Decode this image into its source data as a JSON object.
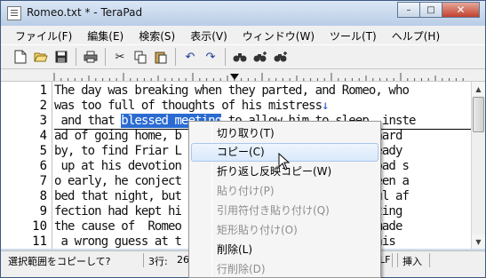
{
  "window": {
    "title": "Romeo.txt * - TeraPad",
    "controls": {
      "minimize": "–",
      "maximize": "□",
      "close": "✕"
    }
  },
  "menubar": [
    "ファイル(F)",
    "編集(E)",
    "検索(S)",
    "表示(V)",
    "ウィンドウ(W)",
    "ツール(T)",
    "ヘルプ(H)"
  ],
  "toolbar": {
    "icons": [
      "new-file-icon",
      "open-folder-icon",
      "save-icon",
      "print-icon",
      "cut-icon",
      "copy-icon",
      "paste-icon",
      "undo-icon",
      "redo-icon",
      "find-icon",
      "find-next-icon",
      "find-prev-icon"
    ],
    "glyphs": {
      "new": "🗋",
      "open": "📂",
      "save": "▣",
      "print": "⎙",
      "cut": "✂",
      "copy": "❐",
      "paste": "▤",
      "undo": "↶",
      "redo": "↷",
      "find": "☌",
      "find_next": "☌",
      "find_prev": "☌"
    }
  },
  "editor": {
    "lines": [
      {
        "num": "1",
        "text": "The day was breaking when they parted, and Romeo, who"
      },
      {
        "num": "2",
        "text": "was too full of thoughts of his mistress",
        "newline": "↓"
      },
      {
        "num": "3",
        "pre": " and that ",
        "selected": "blessed meeting",
        "post": " to allow him to sleep, inste"
      },
      {
        "num": "4",
        "text": "ad of going home, b                          ry hard"
      },
      {
        "num": "5",
        "text": "by, to find Friar L                          already"
      },
      {
        "num": "6",
        "text": " up at his devotion                          abroad s"
      },
      {
        "num": "7",
        "text": "o early, he conject                          t been a"
      },
      {
        "num": "8",
        "text": "bed that night, but                          thful af"
      },
      {
        "num": "9",
        "text": "fection had kept hi                          mputing"
      },
      {
        "num": "10",
        "text": "the cause of  Romeo                          he made"
      },
      {
        "num": "11",
        "text": " a wrong guess at t                          at his"
      }
    ]
  },
  "status": {
    "message": "選択範囲をコピーして?",
    "line_label": "3行:",
    "col_value": "26",
    "newline_type": "LF",
    "mode": "挿入"
  },
  "context_menu": {
    "items": [
      {
        "label": "切り取り(T)",
        "state": "enabled"
      },
      {
        "label": "コピー(C)",
        "state": "hover"
      },
      {
        "label": "折り返し反映コピー(W)",
        "state": "enabled"
      },
      {
        "label": "貼り付け(P)",
        "state": "disabled"
      },
      {
        "label": "引用符付き貼り付け(Q)",
        "state": "disabled"
      },
      {
        "label": "矩形貼り付け(O)",
        "state": "disabled"
      },
      {
        "label": "削除(L)",
        "state": "enabled"
      },
      {
        "label": "行削除(D)",
        "state": "disabled"
      }
    ]
  },
  "colors": {
    "selection": "#2a6bd2",
    "newline_mark": "#2a58c8",
    "menu_hover_border": "#a8c8ec"
  }
}
